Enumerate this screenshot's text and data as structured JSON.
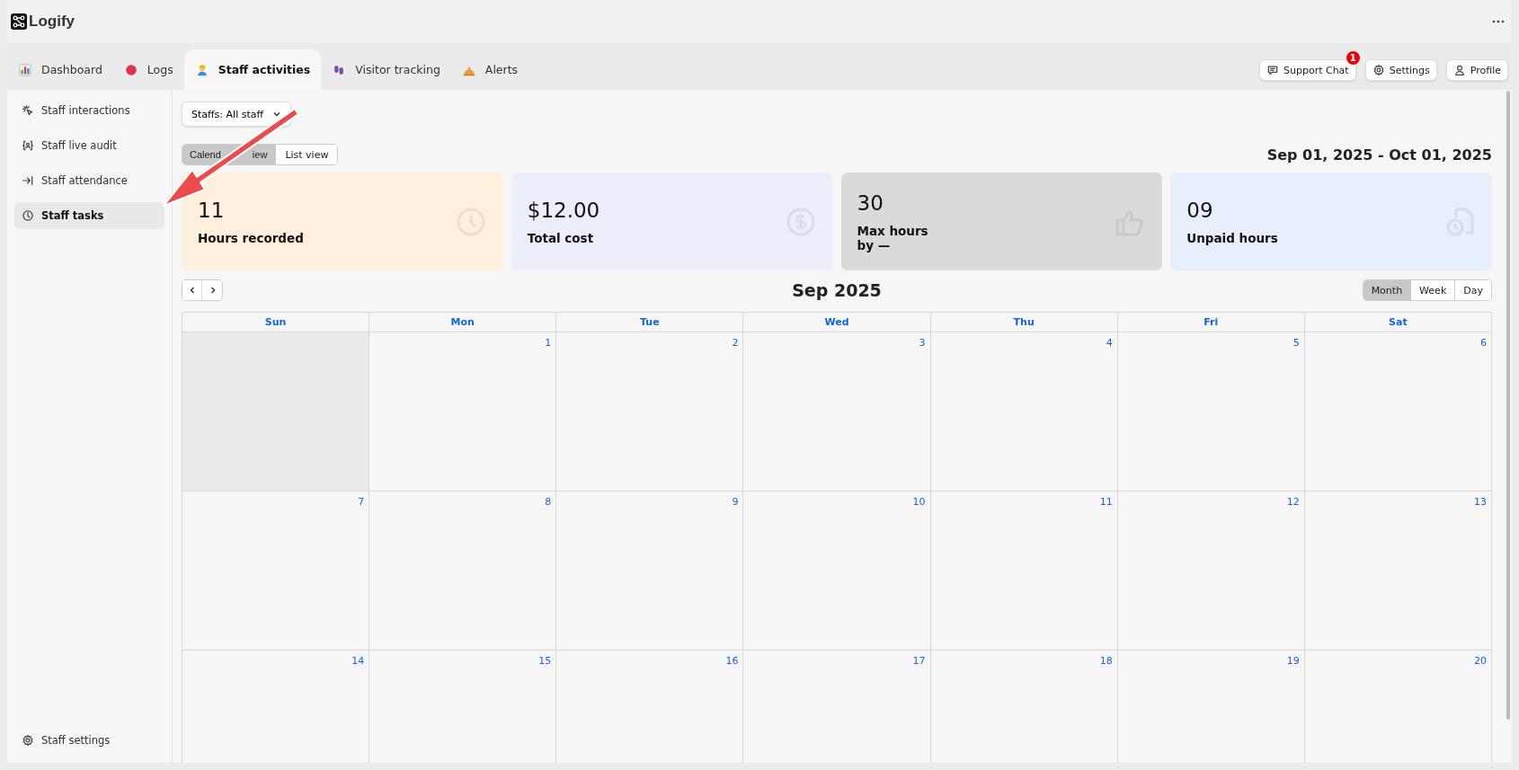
{
  "app": {
    "title": "Logify"
  },
  "tabs": [
    {
      "label": "Dashboard",
      "selected": false
    },
    {
      "label": "Logs",
      "selected": false
    },
    {
      "label": "Staff activities",
      "selected": true
    },
    {
      "label": "Visitor tracking",
      "selected": false
    },
    {
      "label": "Alerts",
      "selected": false
    }
  ],
  "header_buttons": [
    {
      "label": "Support Chat",
      "badge": "1"
    },
    {
      "label": "Settings"
    },
    {
      "label": "Profile"
    }
  ],
  "sidebar": {
    "items": [
      {
        "label": "Staff interactions",
        "selected": false
      },
      {
        "label": "Staff live audit",
        "selected": false
      },
      {
        "label": "Staff attendance",
        "selected": false
      },
      {
        "label": "Staff tasks",
        "selected": true
      }
    ],
    "footer": {
      "label": "Staff settings"
    }
  },
  "filter": {
    "label": "Staffs: All staff"
  },
  "view_toggle": [
    {
      "label_parts": [
        "Calend",
        "iew"
      ],
      "selected": true
    },
    {
      "label": "List view",
      "selected": false
    }
  ],
  "date_range": "Sep 01, 2025 - Oct 01, 2025",
  "stat_cards": [
    {
      "value": "11",
      "label": "Hours recorded",
      "color": "#fef0dc"
    },
    {
      "value": "$12.00",
      "label": "Total cost",
      "color": "#eceffa"
    },
    {
      "value": "30",
      "label": "Max hours\nby —",
      "color": "#dadada"
    },
    {
      "value": "09",
      "label": "Unpaid hours",
      "color": "#e6effb"
    }
  ],
  "calendar": {
    "title": "Sep 2025",
    "modes": [
      {
        "label": "Month",
        "selected": true
      },
      {
        "label": "Week",
        "selected": false
      },
      {
        "label": "Day",
        "selected": false
      }
    ],
    "weekdays": [
      "Sun",
      "Mon",
      "Tue",
      "Wed",
      "Thu",
      "Fri",
      "Sat"
    ],
    "weeks": [
      [
        {
          "kind": "blank"
        },
        {
          "kind": "day",
          "day": "1"
        },
        {
          "kind": "day",
          "day": "2"
        },
        {
          "kind": "day",
          "day": "3"
        },
        {
          "kind": "day",
          "day": "4"
        },
        {
          "kind": "day",
          "day": "5"
        },
        {
          "kind": "day",
          "day": "6"
        }
      ],
      [
        {
          "kind": "day",
          "day": "7"
        },
        {
          "kind": "day",
          "day": "8"
        },
        {
          "kind": "day",
          "day": "9"
        },
        {
          "kind": "day",
          "day": "10"
        },
        {
          "kind": "day",
          "day": "11"
        },
        {
          "kind": "day",
          "day": "12"
        },
        {
          "kind": "day",
          "day": "13"
        }
      ],
      [
        {
          "kind": "day",
          "day": "14"
        },
        {
          "kind": "day",
          "day": "15"
        },
        {
          "kind": "day",
          "day": "16"
        },
        {
          "kind": "day",
          "day": "17"
        },
        {
          "kind": "day",
          "day": "18"
        },
        {
          "kind": "day",
          "day": "19"
        },
        {
          "kind": "day",
          "day": "20"
        }
      ]
    ]
  }
}
